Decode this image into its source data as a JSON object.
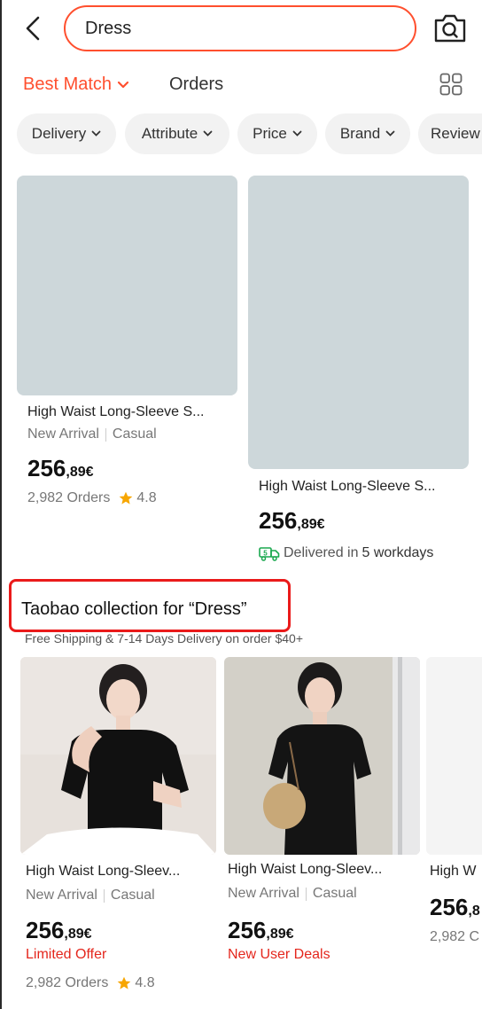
{
  "header": {
    "search_value": "Dress"
  },
  "sort": {
    "best_match": "Best Match",
    "orders": "Orders"
  },
  "filters": [
    "Delivery",
    "Attribute",
    "Price",
    "Brand",
    "Review"
  ],
  "colors": {
    "accent": "#ff4f2e",
    "promo_red": "#e4261c",
    "highlight_box": "#ea1a1a",
    "placeholder": "#cdd7da",
    "star": "#f7a600",
    "delivery_green": "#1aa84f"
  },
  "top_products": [
    {
      "title": "High Waist Long-Sleeve S...",
      "tags": [
        "New Arrival",
        "Casual"
      ],
      "price_main": "256",
      "price_sub": ",89€",
      "orders": "2,982 Orders",
      "rating": "4.8"
    },
    {
      "title": "High Waist Long-Sleeve S...",
      "price_main": "256",
      "price_sub": ",89€",
      "delivery_prefix": "Delivered in ",
      "delivery_days": "5 workdays"
    }
  ],
  "collection": {
    "title": "Taobao collection for “Dress”",
    "subtitle": "Free Shipping & 7-14 Days Delivery on order $40+"
  },
  "collection_products": [
    {
      "title": "High Waist Long-Sleev...",
      "tags": [
        "New Arrival",
        "Casual"
      ],
      "price_main": "256",
      "price_sub": ",89€",
      "promo": "Limited Offer",
      "orders": "2,982 Orders",
      "rating": "4.8"
    },
    {
      "title": "High Waist Long-Sleev...",
      "tags": [
        "New Arrival",
        "Casual"
      ],
      "price_main": "256",
      "price_sub": ",89€",
      "promo": "New User Deals"
    },
    {
      "title": "High W",
      "price_main": "256",
      "price_sub": ",8",
      "orders": "2,982 C"
    }
  ]
}
